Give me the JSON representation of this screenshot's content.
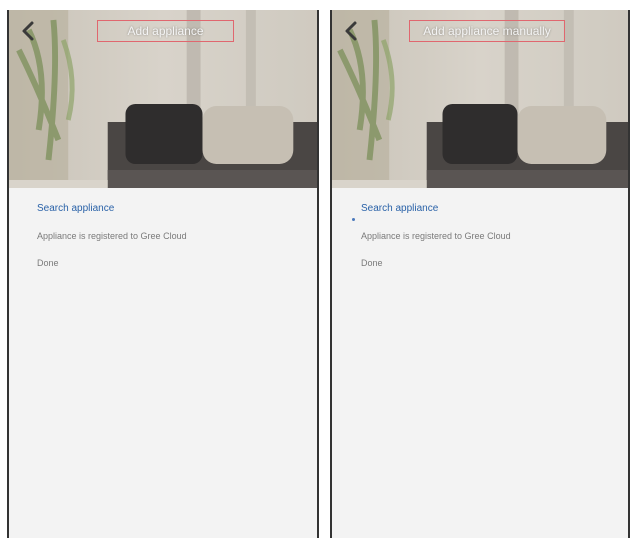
{
  "screens": [
    {
      "header": {
        "title": "Add appliance"
      },
      "steps": [
        "Search appliance",
        "Appliance is registered to Gree Cloud",
        "Done"
      ]
    },
    {
      "header": {
        "title": "Add appliance manually"
      },
      "steps": [
        "Search appliance",
        "Appliance is registered to Gree Cloud",
        "Done"
      ]
    }
  ],
  "colors": {
    "accent": "#2a62a8",
    "highlight_box": "#e0676f",
    "background": "#f3f3f3"
  },
  "icons": {
    "back": "chevron-left-icon"
  }
}
